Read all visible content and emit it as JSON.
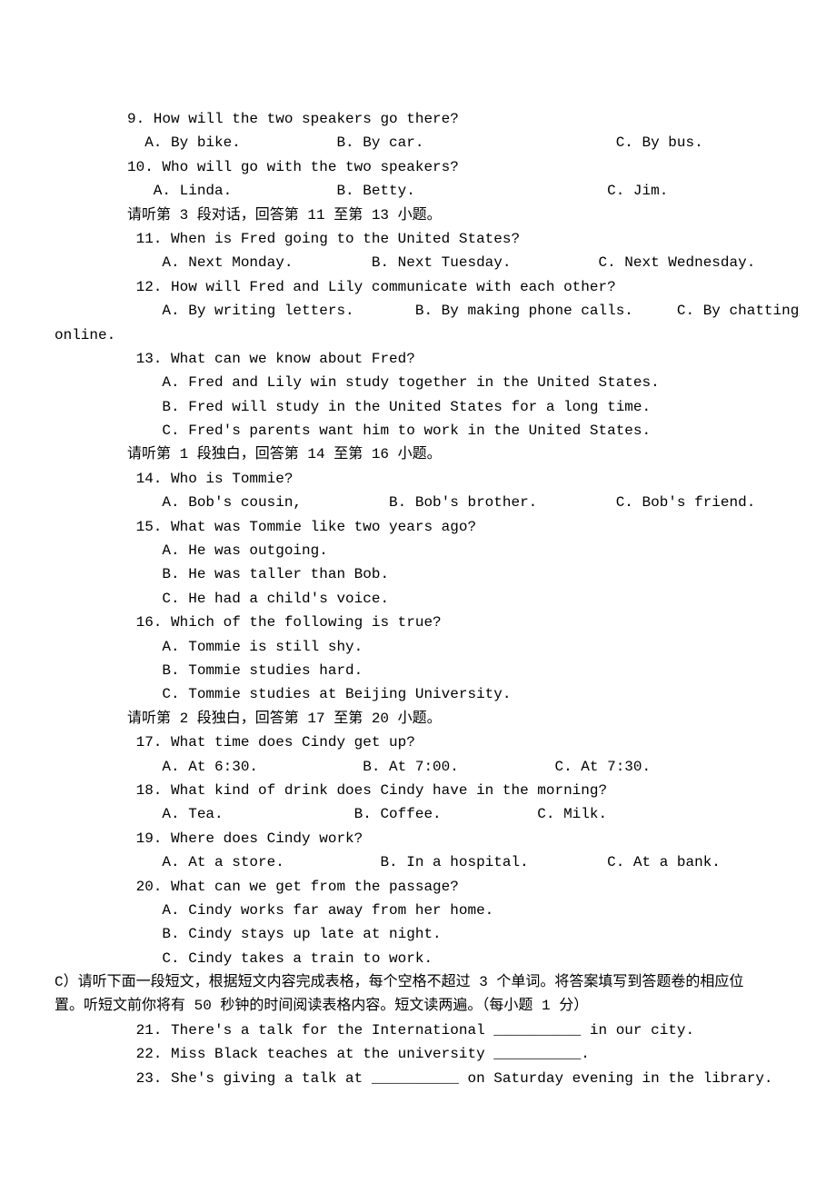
{
  "lines": {
    "q9": "9. How will the two speakers go there?",
    "q9o": "  A. By bike.           B. By car.                      C. By bus.",
    "q10": "10. Who will go with the two speakers?",
    "q10o": "   A. Linda.            B. Betty.                      C. Jim.",
    "instr3": "请听第 3 段对话，回答第 11 至第 13 小题。",
    "q11": " 11. When is Fred going to the United States?",
    "q11o": "    A. Next Monday.         B. Next Tuesday.          C. Next Wednesday.",
    "q12": " 12. How will Fred and Lily communicate with each other?",
    "q12oA": "    A. By writing letters.       B. By making phone calls.     C. By chatting",
    "q12oC": "online.",
    "q13": " 13. What can we know about Fred?",
    "q13a": "    A. Fred and Lily win study together in the United States.",
    "q13b": "    B. Fred will study in the United States for a long time.",
    "q13c": "    C. Fred's parents want him to work in the United States.",
    "instr4": "请听第 1 段独白，回答第 14 至第 16 小题。",
    "q14": " 14. Who is Tommie?",
    "q14o": "    A. Bob's cousin,          B. Bob's brother.         C. Bob's friend.",
    "q15": " 15. What was Tommie like two years ago?",
    "q15a": "    A. He was outgoing.",
    "q15b": "    B. He was taller than Bob.",
    "q15c": "    C. He had a child's voice.",
    "q16": " 16. Which of the following is true?",
    "q16a": "    A. Tommie is still shy.",
    "q16b": "    B. Tommie studies hard.",
    "q16c": "    C. Tommie studies at Beijing University.",
    "instr5": "请听第 2 段独白，回答第 17 至第 20 小题。",
    "q17": " 17. What time does Cindy get up?",
    "q17o": "    A. At 6:30.            B. At 7:00.           C. At 7:30.",
    "q18": " 18. What kind of drink does Cindy have in the morning?",
    "q18o": "    A. Tea.               B. Coffee.           C. Milk.",
    "q19": " 19. Where does Cindy work?",
    "q19o": "    A. At a store.           B. In a hospital.         C. At a bank.",
    "q20": " 20. What can we get from the passage?",
    "q20a": "    A. Cindy works far away from her home.",
    "q20b": "    B. Cindy stays up late at night.",
    "q20c": "    C. Cindy takes a train to work.",
    "sectionC": "    C）请听下面一段短文，根据短文内容完成表格，每个空格不超过 3 个单词。将答案填写到答题卷的相应位置。听短文前你将有 50 秒钟的时间阅读表格内容。短文读两遍。（每小题 1 分）",
    "q21": " 21. There's a talk for the International __________ in our city.",
    "q22": " 22. Miss Black teaches at the university __________.",
    "q23": " 23. She's giving a talk at __________ on Saturday evening in the library."
  }
}
